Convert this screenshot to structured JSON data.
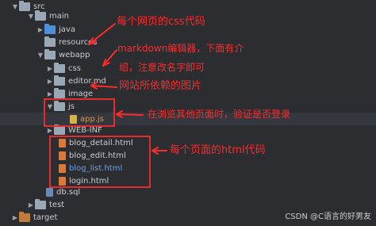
{
  "tree": {
    "items": [
      {
        "name": "src"
      },
      {
        "name": "main"
      },
      {
        "name": "java"
      },
      {
        "name": "resources"
      },
      {
        "name": "webapp"
      },
      {
        "name": "css"
      },
      {
        "name": "editor.md"
      },
      {
        "name": "image"
      },
      {
        "name": "js"
      },
      {
        "name": "app.js"
      },
      {
        "name": "WEB-INF"
      },
      {
        "name": "blog_detail.html"
      },
      {
        "name": "blog_edit.html"
      },
      {
        "name": "blog_list.html"
      },
      {
        "name": "login.html"
      },
      {
        "name": "db.sql"
      },
      {
        "name": "test"
      },
      {
        "name": "target"
      }
    ]
  },
  "annotations": {
    "css": "每个网页的css代码",
    "editor_line1": "markdown编辑器，下面有介",
    "editor_line2": "绍，注意改名字即可",
    "image": "网站所依赖的图片",
    "appjs": "在浏览其他页面时，验证是否登录",
    "html": "每个页面的html代码"
  },
  "watermark": "CSDN @C语言的好男友",
  "colors": {
    "annotation": "#ff2a2a",
    "box": "#e52b2b",
    "background": "#2b2d30"
  }
}
